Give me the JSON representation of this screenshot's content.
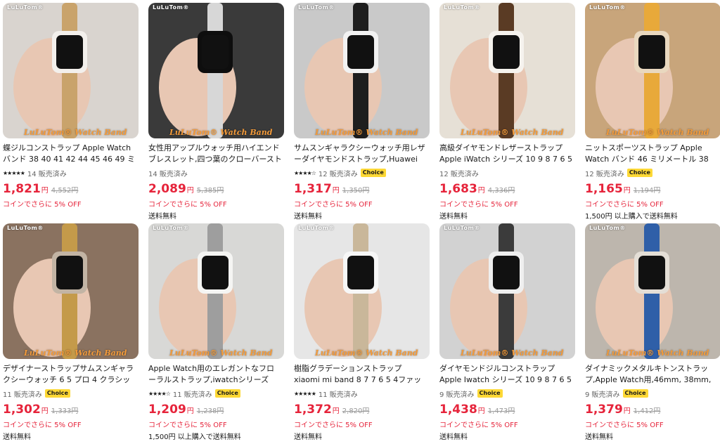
{
  "products": [
    {
      "title": "蝶ジルコンストラップ Apple Watch バンド 38 40 41 42 44 45 46 49 ミリメートル iWatch...",
      "stars": "★★★★★",
      "sold": "14 販売済み",
      "choice": "",
      "price": "1,821",
      "yen": "円",
      "original": "4,552円",
      "coupon": "コインでさらに 5% OFF",
      "shipping": "",
      "brand": "LuLuTom®",
      "watermark": "LuLuTom® Watch Band",
      "colors": [
        "#d9d4cf",
        "#f3f0ec",
        "#c9a36b"
      ]
    },
    {
      "title": "女性用アップルウォッチ用ハイエンドブレスレット,四つ葉のクローバーストラップ,iwatchシリー...",
      "stars": "",
      "sold": "14 販売済み",
      "choice": "",
      "price": "2,089",
      "yen": "円",
      "original": "5,385円",
      "coupon": "コインでさらに 5% OFF",
      "shipping": "送料無料",
      "brand": "LuLuTom®",
      "watermark": "LuLuTom® Watch Band",
      "colors": [
        "#3a3a3a",
        "#0e0e0e",
        "#d7d7d7"
      ]
    },
    {
      "title": "サムスンギャラクシーウォッチ用レザーダイヤモンドストラップ,Huawei Watch gt 4 3 5,7,6,5...",
      "stars": "★★★★☆",
      "sold": "12 販売済み",
      "choice": "Choice",
      "price": "1,317",
      "yen": "円",
      "original": "1,350円",
      "coupon": "コインでさらに 5% OFF",
      "shipping": "送料無料",
      "brand": "LuLuTom®",
      "watermark": "LuLuTom® Watch Band",
      "colors": [
        "#c9c9c9",
        "#f2f2f2",
        "#1e1e1e"
      ]
    },
    {
      "title": "高級ダイヤモンドレザーストラップ Apple iWatch シリーズ 10 9 8 7 6 5 2 SE ウルトラ...",
      "stars": "",
      "sold": "12 販売済み",
      "choice": "",
      "price": "1,683",
      "yen": "円",
      "original": "4,336円",
      "coupon": "コインでさらに 5% OFF",
      "shipping": "送料無料",
      "brand": "LuLuTom®",
      "watermark": "LuLuTom® Watch Band",
      "colors": [
        "#e6e0d6",
        "#f6f3ee",
        "#5a3b24"
      ]
    },
    {
      "title": "ニットスポーツストラップ Apple Watch バンド 46 ミリメートル 38 40 41 ミリメートル 44 ミリ...",
      "stars": "",
      "sold": "12 販売済み",
      "choice": "Choice",
      "price": "1,165",
      "yen": "円",
      "original": "1,194円",
      "coupon": "コインでさらに 5% OFF",
      "shipping": "1,500円 以上購入で送料無料",
      "brand": "LuLuTom®",
      "watermark": "LuLuTom® Watch Band",
      "colors": [
        "#c8a57b",
        "#e9d8bf",
        "#e8a93a"
      ]
    },
    {
      "title": "デザイナーストラップサムスンギャラクシーウォッチ 6 5 プロ 4 クラシック 44 40 46 ミリメートル...",
      "stars": "",
      "sold": "11 販売済み",
      "choice": "Choice",
      "price": "1,302",
      "yen": "円",
      "original": "1,333円",
      "coupon": "コインでさらに 5% OFF",
      "shipping": "送料無料",
      "brand": "LuLuTom®",
      "watermark": "LuLuTom® Watch Band",
      "colors": [
        "#8a7260",
        "#c2b4a4",
        "#c49a4a"
      ]
    },
    {
      "title": "Apple Watch用のエレガントなフローラルストラップ,iwatchシリーズ10,9,8,7,6,5,se ultra...",
      "stars": "★★★★☆",
      "sold": "11 販売済み",
      "choice": "Choice",
      "price": "1,209",
      "yen": "円",
      "original": "1,238円",
      "coupon": "コインでさらに 5% OFF",
      "shipping": "1,500円 以上購入で送料無料",
      "brand": "LuLuTom®",
      "watermark": "LuLuTom® Watch Band",
      "colors": [
        "#d8d8d6",
        "#f5f5f3",
        "#9e9e9e"
      ]
    },
    {
      "title": "樹脂グラデーションストラップxiaomi mi band 8 7 7 6 5 4ファッションラブアンバーストーンブ...",
      "stars": "★★★★★",
      "sold": "11 販売済み",
      "choice": "",
      "price": "1,372",
      "yen": "円",
      "original": "2,820円",
      "coupon": "コインでさらに 5% OFF",
      "shipping": "送料無料",
      "brand": "LuLuTom®",
      "watermark": "LuLuTom® Watch Band",
      "colors": [
        "#e6e6e6",
        "#f7f7f7",
        "#c9b79a"
      ]
    },
    {
      "title": "ダイヤモンドジルコンストラップ Apple Iwatch シリーズ 10 9 8 7 6 5 4 ウルトラ 2 女性ジュ...",
      "stars": "",
      "sold": "9 販売済み",
      "choice": "Choice",
      "price": "1,438",
      "yen": "円",
      "original": "1,473円",
      "coupon": "コインでさらに 5% OFF",
      "shipping": "送料無料",
      "brand": "LuLuTom®",
      "watermark": "LuLuTom® Watch Band",
      "colors": [
        "#d2d2d2",
        "#efefef",
        "#3b3b3b"
      ]
    },
    {
      "title": "ダイナミックメタルキトンストラップ,Apple Watch用,46mm, 38mm, 41mm, 40mm,...",
      "stars": "",
      "sold": "9 販売済み",
      "choice": "Choice",
      "price": "1,379",
      "yen": "円",
      "original": "1,412円",
      "coupon": "コインでさらに 5% OFF",
      "shipping": "送料無料",
      "brand": "LuLuTom®",
      "watermark": "LuLuTom® Watch Band",
      "colors": [
        "#bdb6ad",
        "#e4ded6",
        "#2f5fa8"
      ]
    }
  ]
}
